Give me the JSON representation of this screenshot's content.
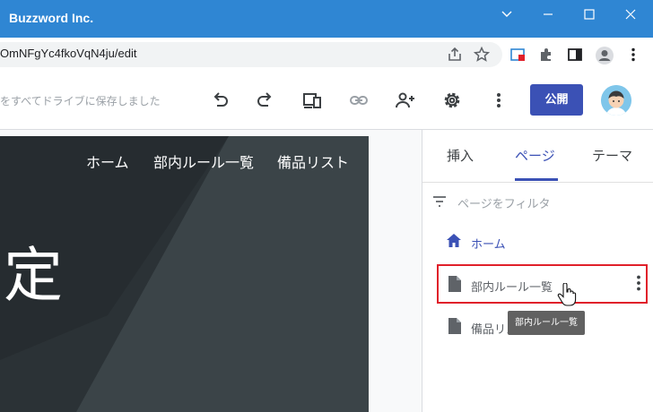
{
  "window": {
    "title": "Buzzword Inc.",
    "titlebar_color": "#2f86d3"
  },
  "address_bar": {
    "url": "OmNFgYc4fkoVqN4ju/edit"
  },
  "toolbar": {
    "save_status": "をすべてドライブに保存しました",
    "publish_label": "公開",
    "accent_color": "#3b51b5",
    "icons": [
      "undo-icon",
      "redo-icon",
      "device-preview-icon",
      "link-icon",
      "share-add-person-icon",
      "settings-icon",
      "more-vert-icon"
    ]
  },
  "site": {
    "nav": [
      "ホーム",
      "部内ルール一覧",
      "備品リスト"
    ],
    "hero_text": "定"
  },
  "panel": {
    "tabs": [
      "挿入",
      "ページ",
      "テーマ"
    ],
    "active_tab": "ページ",
    "filter_placeholder": "ページをフィルタ",
    "pages": [
      {
        "label": "ホーム",
        "icon": "home-icon"
      },
      {
        "label": "部内ルール一覧",
        "icon": "page-icon"
      },
      {
        "label": "備品リスト",
        "icon": "page-icon"
      }
    ],
    "tooltip": "部内ルール一覧"
  }
}
